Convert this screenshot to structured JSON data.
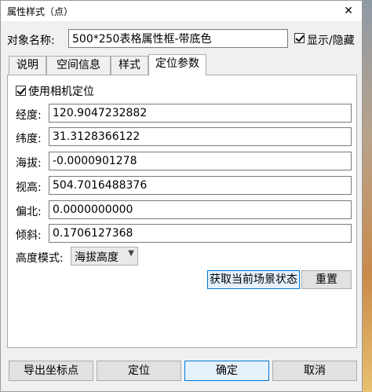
{
  "window": {
    "title": "属性样式（点）",
    "close_glyph": "✕"
  },
  "object_name": {
    "label": "对象名称:",
    "value": "500*250表格属性框-带底色"
  },
  "show_hide": {
    "label": "显示/隐藏",
    "checked": true
  },
  "tabs": [
    {
      "label": "说明",
      "active": false
    },
    {
      "label": "空间信息",
      "active": false
    },
    {
      "label": "样式",
      "active": false
    },
    {
      "label": "定位参数",
      "active": true
    }
  ],
  "use_camera": {
    "label": "使用相机定位",
    "checked": true
  },
  "fields": [
    {
      "label": "经度:",
      "value": "120.9047232882"
    },
    {
      "label": "纬度:",
      "value": "31.3128366122"
    },
    {
      "label": "海拔:",
      "value": "-0.0000901278"
    },
    {
      "label": "视高:",
      "value": "504.7016488376"
    },
    {
      "label": "偏北:",
      "value": "0.0000000000"
    },
    {
      "label": "倾斜:",
      "value": "0.1706127368"
    }
  ],
  "height_mode": {
    "label": "高度模式:",
    "selected": "海拔高度",
    "arrow_icon": "chevron-down-icon"
  },
  "actions": {
    "get_scene_state": "获取当前场景状态",
    "reset": "重置"
  },
  "bottom_buttons": {
    "export": "导出坐标点",
    "locate": "定位",
    "ok": "确定",
    "cancel": "取消"
  }
}
